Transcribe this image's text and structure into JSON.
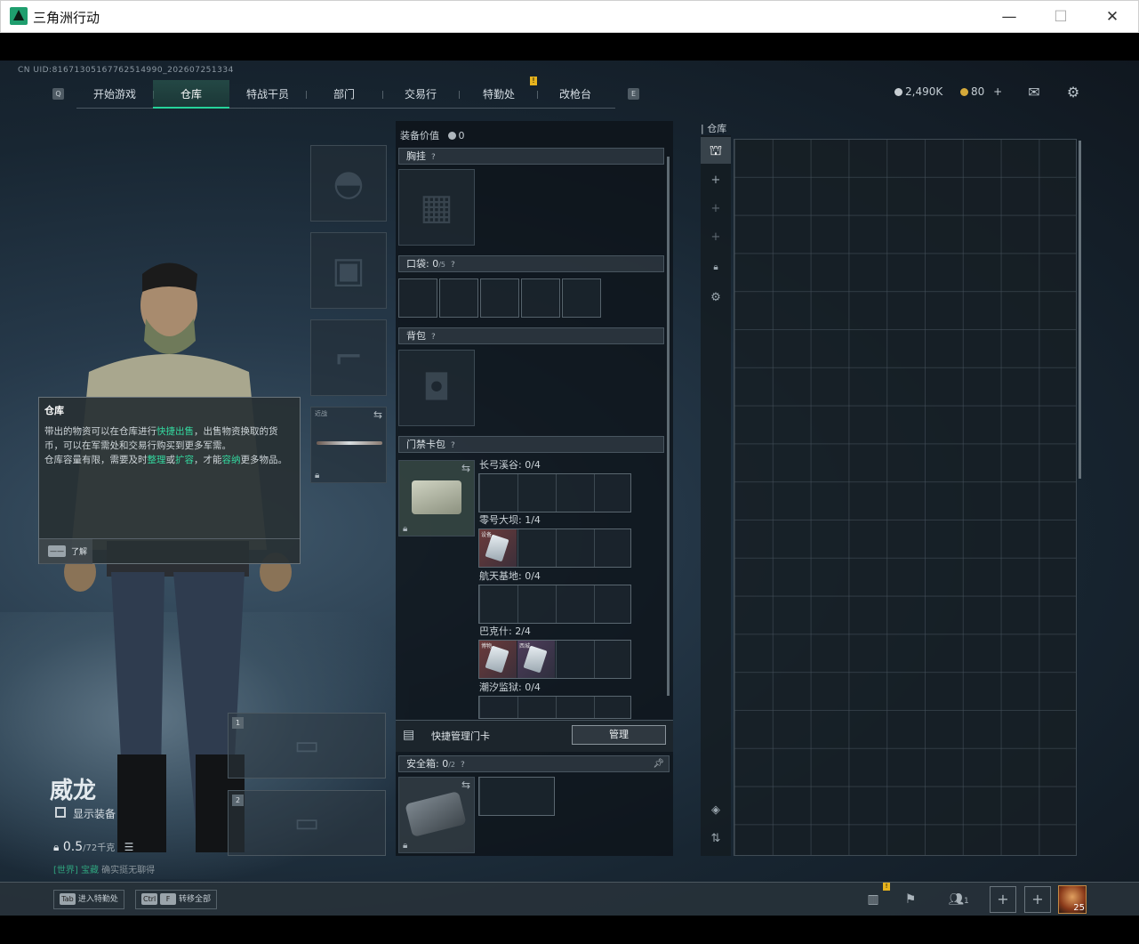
{
  "window": {
    "title": "三角洲行动",
    "minimize": "—",
    "maximize": "☐",
    "close": "✕"
  },
  "uid": "CN UID:8167130516776251499‌0_202607251334",
  "nav": {
    "key_left": "Q",
    "key_right": "E",
    "tabs": [
      {
        "label": "开始游戏",
        "active": false
      },
      {
        "label": "仓库",
        "active": true
      },
      {
        "label": "特战干员",
        "active": false
      },
      {
        "label": "部门",
        "active": false
      },
      {
        "label": "交易行",
        "active": false
      },
      {
        "label": "特勤处",
        "active": false
      },
      {
        "label": "改枪台",
        "active": false
      }
    ],
    "badge": "!"
  },
  "currency": {
    "coins": "2,490K",
    "tickets": "80",
    "add": "+"
  },
  "loadout": {
    "value_label": "装备价值",
    "value": "0",
    "chest_rig": "胸挂",
    "help": "?",
    "pocket_label": "口袋:",
    "pocket_count": "0",
    "pocket_max": "/5",
    "backpack": "背包",
    "keycard_case": "门禁卡包",
    "maps": [
      {
        "name": "长弓溪谷: 0/4"
      },
      {
        "name": "零号大坝: 1/4"
      },
      {
        "name": "航天基地: 0/4"
      },
      {
        "name": "巴克什: 2/4"
      },
      {
        "name": "潮汐监狱: 0/4"
      }
    ],
    "card_tags": [
      "设备",
      "博物",
      "西城"
    ],
    "quick_manage": "快捷管理门卡",
    "manage_button": "管理",
    "safe_box_label": "安全箱:",
    "safe_box_count": "0",
    "safe_box_max": "/2",
    "melee_label": "近战"
  },
  "stash": {
    "title": "仓库"
  },
  "tooltip": {
    "title": "仓库",
    "line1_a": "带出的物资可以在仓库进行",
    "line1_hl": "快捷出售",
    "line1_b": "，出售物资换取的货币，可以在军需处和交易行购买到更多军需。",
    "line2_a": "仓库容量有限，需要及时",
    "line2_hl1": "整理",
    "line2_or": "或",
    "line2_hl2": "扩容",
    "line2_b": "，才能",
    "line2_hl3": "容纳",
    "line2_c": "更多物品。",
    "key": "——",
    "ok": "了解"
  },
  "character": {
    "name": "威龙",
    "show_gear": "显示装备",
    "weight": "0.5",
    "weight_max": "/72千克",
    "ticker_a": "[世界] 宝藏",
    "ticker_b": "确实挺无聊得"
  },
  "bottom": {
    "hint1_key": "Tab",
    "hint1": "进入特勤处",
    "hint2_key1": "Ctrl",
    "hint2_key2": "F",
    "hint2": "转移全部",
    "friends": "1",
    "level": "25"
  }
}
